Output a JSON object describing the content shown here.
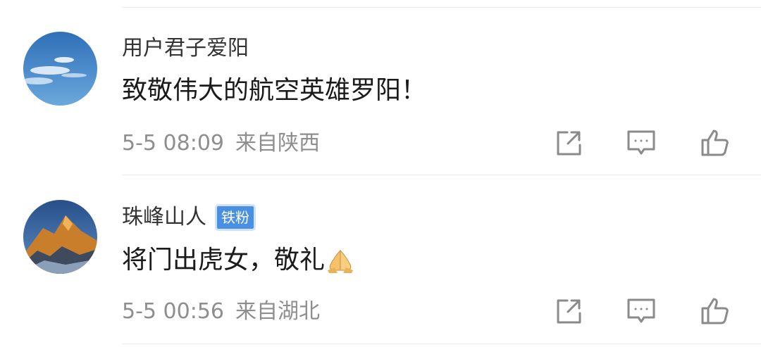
{
  "comments": [
    {
      "username": "用户君子爱阳",
      "badge": "",
      "text": "致敬伟大的航空英雄罗阳！",
      "time": "5-5 08:09",
      "location": "来自陕西",
      "avatar": "sky-clouds-avatar"
    },
    {
      "username": "珠峰山人",
      "badge": "铁粉",
      "text": "将门出虎女，敬礼",
      "emoji": "folded-hands-emoji",
      "time": "5-5 00:56",
      "location": "来自湖北",
      "avatar": "mountain-peak-avatar"
    }
  ],
  "actions": [
    "share-icon",
    "reply-icon",
    "like-icon"
  ],
  "colors": {
    "text": "#1a1a1a",
    "username": "#333333",
    "meta": "#8e8e8e",
    "badge": "#4a90e2",
    "icon": "#8a8a8a"
  }
}
